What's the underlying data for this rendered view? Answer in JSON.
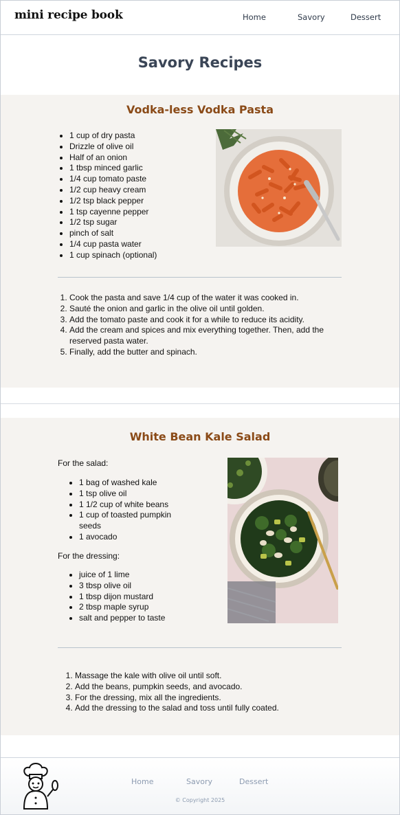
{
  "header": {
    "brand": "mini recipe book",
    "nav": [
      "Home",
      "Savory",
      "Dessert"
    ]
  },
  "page_title": "Savory Recipes",
  "recipes": [
    {
      "title": "Vodka-less Vodka Pasta",
      "ingredients": [
        "1 cup of dry pasta",
        "Drizzle of olive oil",
        "Half of an onion",
        "1 tbsp minced garlic",
        "1/4 cup tomato paste",
        "1/2 cup heavy cream",
        "1/2 tsp black pepper",
        "1 tsp cayenne pepper",
        "1/2 tsp sugar",
        "pinch of salt",
        "1/4 cup pasta water",
        "1 cup spinach (optional)"
      ],
      "steps": [
        "Cook the pasta and save 1/4 cup of the water it was cooked in.",
        "Sauté the onion and garlic in the olive oil until golden.",
        "Add the tomato paste and cook it for a while to reduce its acidity.",
        "Add the cream and spices and mix everything together. Then, add the reserved pasta water.",
        "Finally, add the butter and spinach."
      ]
    },
    {
      "title": "White Bean Kale Salad",
      "salad_label": "For the salad:",
      "salad_ingredients": [
        "1 bag of washed kale",
        "1 tsp olive oil",
        "1 1/2 cup of white beans",
        "1 cup of toasted pumpkin seeds",
        "1 avocado"
      ],
      "dressing_label": "For the dressing:",
      "dressing_ingredients": [
        "juice of 1 lime",
        "3 tbsp olive oil",
        "1 tbsp dijon mustard",
        "2 tbsp maple syrup",
        "salt and pepper to taste"
      ],
      "steps": [
        "Massage the kale with olive oil until soft.",
        "Add the beans, pumpkin seeds, and avocado.",
        "For the dressing, mix all the ingredients.",
        "Add the dressing to the salad and toss until fully coated."
      ]
    }
  ],
  "footer": {
    "nav": [
      "Home",
      "Savory",
      "Dessert"
    ],
    "copyright": "© Copyright 2025"
  },
  "colors": {
    "accent": "#8a4a17",
    "card_bg": "#f5f3f0",
    "nav_text": "#2f3a4a",
    "footer_text": "#8c9bb0"
  }
}
